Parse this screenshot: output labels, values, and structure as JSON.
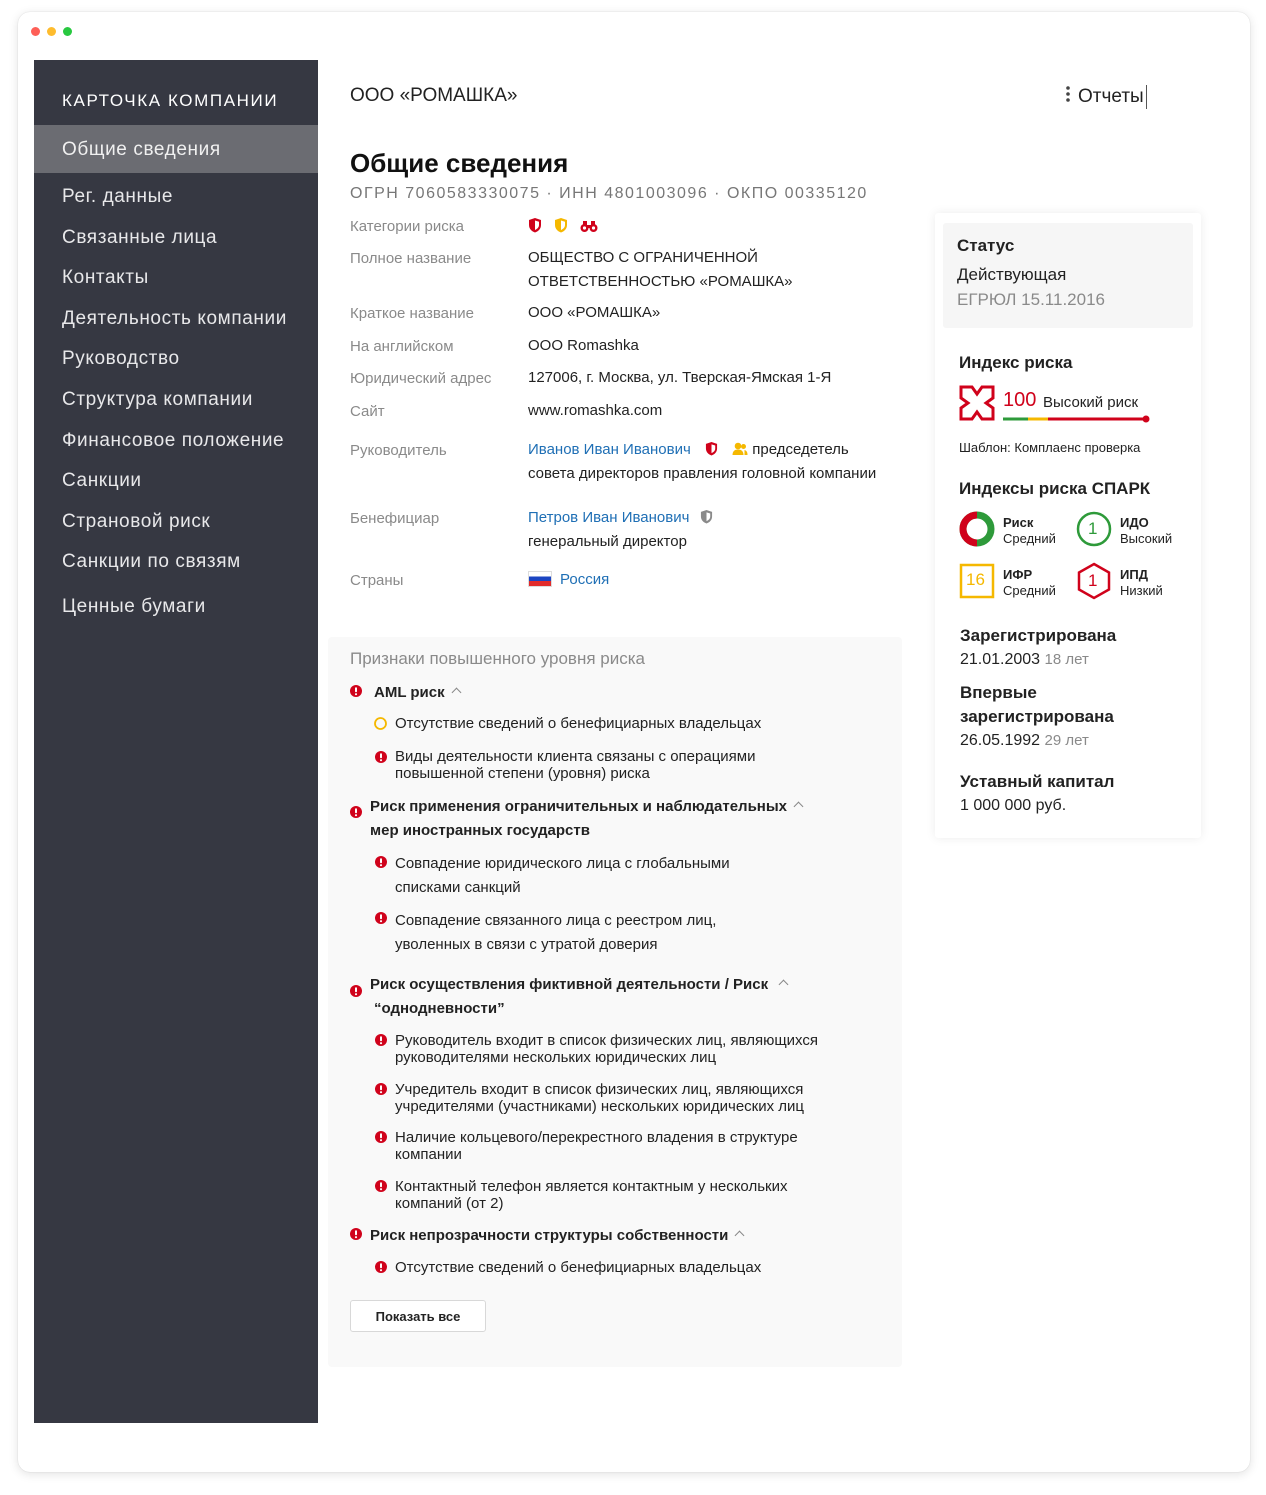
{
  "sidebar": {
    "title": "КАРТОЧКА КОМПАНИИ",
    "items": [
      {
        "label": "Общие сведения"
      },
      {
        "label": "Рег. данные"
      },
      {
        "label": "Связанные лица"
      },
      {
        "label": "Контакты"
      },
      {
        "label": "Деятельность компании"
      },
      {
        "label": "Руководство"
      },
      {
        "label": "Структура компании"
      },
      {
        "label": "Финансовое положение"
      },
      {
        "label": "Санкции"
      },
      {
        "label": "Страновой риск"
      },
      {
        "label": "Санкции по связям"
      },
      {
        "label": "Ценные бумаги"
      }
    ]
  },
  "header": {
    "company": "ООО «РОМАШКА»",
    "reports": "Отчеты"
  },
  "page": {
    "title": "Общие сведения",
    "codes": "ОГРН 7060583330075 · ИНН 4801003096 · ОКПО 00335120"
  },
  "info": {
    "risk_categories_label": "Категории риска",
    "full_name_label": "Полное название",
    "full_name_line1": "ОБЩЕСТВО С ОГРАНИЧЕННОЙ",
    "full_name_line2": "ОТВЕТСТВЕННОСТЬЮ «РОМАШКА»",
    "short_name_label": "Краткое название",
    "short_name": "ООО «РОМАШКА»",
    "english_label": "На английском",
    "english": "OOO Romashka",
    "address_label": "Юридический адрес",
    "address": "127006, г. Москва, ул. Тверская-Ямская 1-Я",
    "site_label": "Сайт",
    "site": "www.romashka.com",
    "head_label": "Руководитель",
    "head_name": "Иванов Иван Иванович",
    "head_role1": "председетель",
    "head_role2": "совета директоров правления головной компании",
    "beneficiary_label": "Бенефициар",
    "beneficiary_name": "Петров Иван Иванович",
    "beneficiary_role": "генеральный директор",
    "countries_label": "Страны",
    "country": "Россия"
  },
  "risk_signs": {
    "title": "Признаки повышенного уровня риска",
    "groups": [
      {
        "title": "AML риск",
        "items": [
          "Отсутствие сведений о бенефициарных владельцах",
          "Виды деятельности клиента связаны с операциями",
          "повышенной степени (уровня) риска"
        ]
      },
      {
        "title": "Риск применения ограничительных и наблюдательных",
        "title2": "мер иностранных государств",
        "items": [
          "Совпадение юридического лица с глобальными",
          "списками санкций",
          "Совпадение связанного лица с реестром лиц,",
          "уволенных в связи с утратой доверия"
        ]
      },
      {
        "title": "Риск осуществления фиктивной деятельности / Риск",
        "title2": "“однодневности”",
        "items": [
          "Руководитель входит в список физических лиц, являющихся",
          "руководителями нескольких юридических лиц",
          "Учредитель входит в список физических лиц, являющихся",
          "учредителями (участниками) нескольких юридических лиц",
          "Наличие кольцевого/перекрестного владения в структуре",
          "компании",
          "Контактный телефон является контактным у нескольких",
          "компаний (от 2)"
        ]
      },
      {
        "title": "Риск непрозрачности структуры собственности",
        "items": [
          "Отсутствие сведений о бенефициарных владельцах"
        ]
      }
    ],
    "show_all": "Показать все"
  },
  "status": {
    "label": "Статус",
    "value": "Действующая",
    "source": "ЕГРЮЛ 15.11.2016",
    "risk_index_label": "Индекс риска",
    "risk_index_value": "100",
    "risk_index_text": "Высокий риск",
    "template": "Шаблон: Комплаенс проверка",
    "spark_label": "Индексы риска СПАРК",
    "spark": [
      {
        "name": "Риск",
        "level": "Средний"
      },
      {
        "name": "ИДО",
        "level": "Высокий",
        "value": "1"
      },
      {
        "name": "ИФР",
        "level": "Средний",
        "value": "16"
      },
      {
        "name": "ИПД",
        "level": "Низкий",
        "value": "1"
      }
    ],
    "registered_label": "Зарегистрирована",
    "registered_date": "21.01.2003",
    "registered_age": "18 лет",
    "first_registered_label1": "Впервые",
    "first_registered_label2": "зарегистрирована",
    "first_registered_date": "26.05.1992",
    "first_registered_age": "29 лет",
    "capital_label": "Уставный капитал",
    "capital": "1 000 000 руб."
  },
  "colors": {
    "sidebar_bg": "#363842",
    "sidebar_active": "#6b6c72",
    "danger": "#d0021b",
    "warning": "#f5b800",
    "success": "#2e9a3a",
    "link": "#1f6fb5"
  }
}
